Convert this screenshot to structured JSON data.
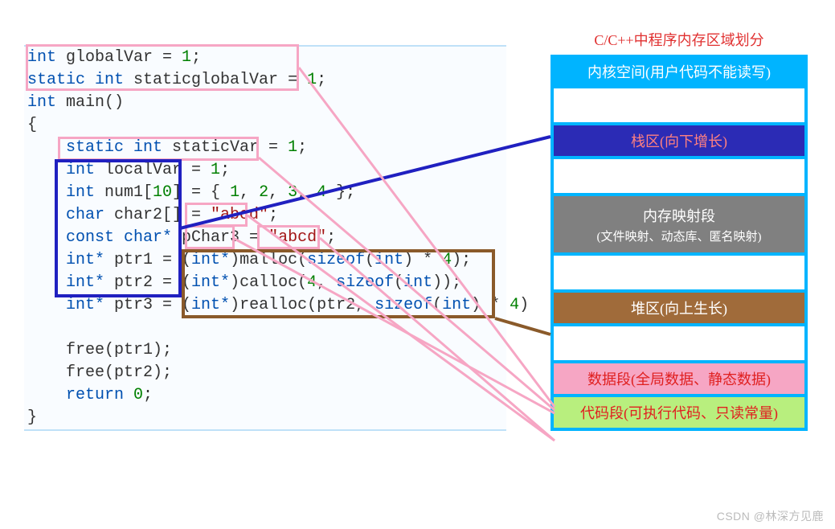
{
  "title": "C/C++中程序内存区域划分",
  "memory": {
    "kernel": "内核空间(用户代码不能读写)",
    "stack": "栈区(向下增长)",
    "mmap": "内存映射段",
    "mmap_sub": "(文件映射、动态库、匿名映射)",
    "heap": "堆区(向上生长)",
    "data": "数据段(全局数据、静态数据)",
    "code": "代码段(可执行代码、只读常量)"
  },
  "code": {
    "l1a": "int",
    "l1b": " globalVar = ",
    "l1c": "1",
    "l1d": ";",
    "l2a": "static int",
    "l2b": " staticglobalVar = ",
    "l2c": "1",
    "l2d": ";",
    "l3a": "int",
    "l3b": " main()",
    "l4": "{",
    "l5a": "    static int",
    "l5b": " staticVar = ",
    "l5c": "1",
    "l5d": ";",
    "l6a": "    int",
    "l6b": " localVar = ",
    "l6c": "1",
    "l6d": ";",
    "l7a": "    int",
    "l7b": " num1[",
    "l7c": "10",
    "l7d": "] = { ",
    "l7e": "1",
    "l7f": ", ",
    "l7g": "2",
    "l7h": ", ",
    "l7i": "3",
    "l7j": ", ",
    "l7k": "4",
    "l7l": " };",
    "l8a": "    char",
    "l8b": " char2[] = ",
    "l8c": "\"abcd\"",
    "l8d": ";",
    "l9a": "    const char*",
    "l9b": " pChar3 = ",
    "l9c": "\"abcd\"",
    "l9d": ";",
    "l10a": "    int*",
    "l10b": " ptr1 = (",
    "l10c": "int*",
    "l10d": ")malloc(",
    "l10e": "sizeof",
    "l10f": "(",
    "l10g": "int",
    "l10h": ") * ",
    "l10i": "4",
    "l10j": ");",
    "l11a": "    int*",
    "l11b": " ptr2 = (",
    "l11c": "int*",
    "l11d": ")calloc(",
    "l11e": "4",
    "l11f": ", ",
    "l11g": "sizeof",
    "l11h": "(",
    "l11i": "int",
    "l11j": "));",
    "l12a": "    int*",
    "l12b": " ptr3 = (",
    "l12c": "int*",
    "l12d": ")realloc(ptr2, ",
    "l12e": "sizeof",
    "l12f": "(",
    "l12g": "int",
    "l12h": ") * ",
    "l12i": "4",
    "l12j": ")",
    "l13": " ",
    "l14": "    free(ptr1);",
    "l15": "    free(ptr2);",
    "l16a": "    return ",
    "l16b": "0",
    "l16c": ";",
    "l17": "}"
  },
  "watermark": "CSDN @林深方见鹿"
}
